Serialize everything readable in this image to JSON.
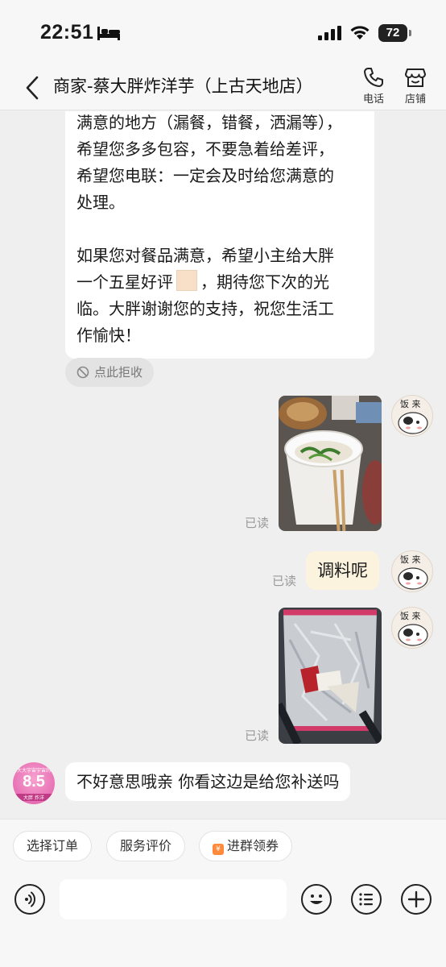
{
  "status_bar": {
    "time": "22:51",
    "battery": "72"
  },
  "header": {
    "title": "商家-蔡大胖炸洋芋（上古天地店）",
    "phone_label": "电话",
    "store_label": "店铺"
  },
  "messages": {
    "merchant_long": {
      "para1": "满意的地方（漏餐，错餐，洒漏等），\n希望您多多包容，不要急着给差评，\n希望您电联：一定会及时给您满意的\n处理。",
      "para2_a": "如果您对餐品满意，希望小主给大胖\n一个五星好评",
      "para2_b": "，期待您下次的光\n临。大胖谢谢您的支持，祝您生活工\n作愉快！"
    },
    "reject_label": "点此拒收",
    "read_label": "已读",
    "user_text": "调料呢",
    "merchant_reply": "不好意思哦亲 你看这边是给您补送吗"
  },
  "merchant_avatar": {
    "score": "8.5",
    "top_text": "大大宇宙宇宙的",
    "bottom_text": "大胖 炸洋"
  },
  "user_avatar": {
    "text": "饭 来"
  },
  "quick_actions": {
    "select_order": "选择订单",
    "service_review": "服务评价",
    "join_group": "进群领券"
  },
  "input": {
    "placeholder": ""
  },
  "colors": {
    "user_bubble": "#fcf3df",
    "merchant_bubble": "#ffffff",
    "background": "#efefef"
  }
}
